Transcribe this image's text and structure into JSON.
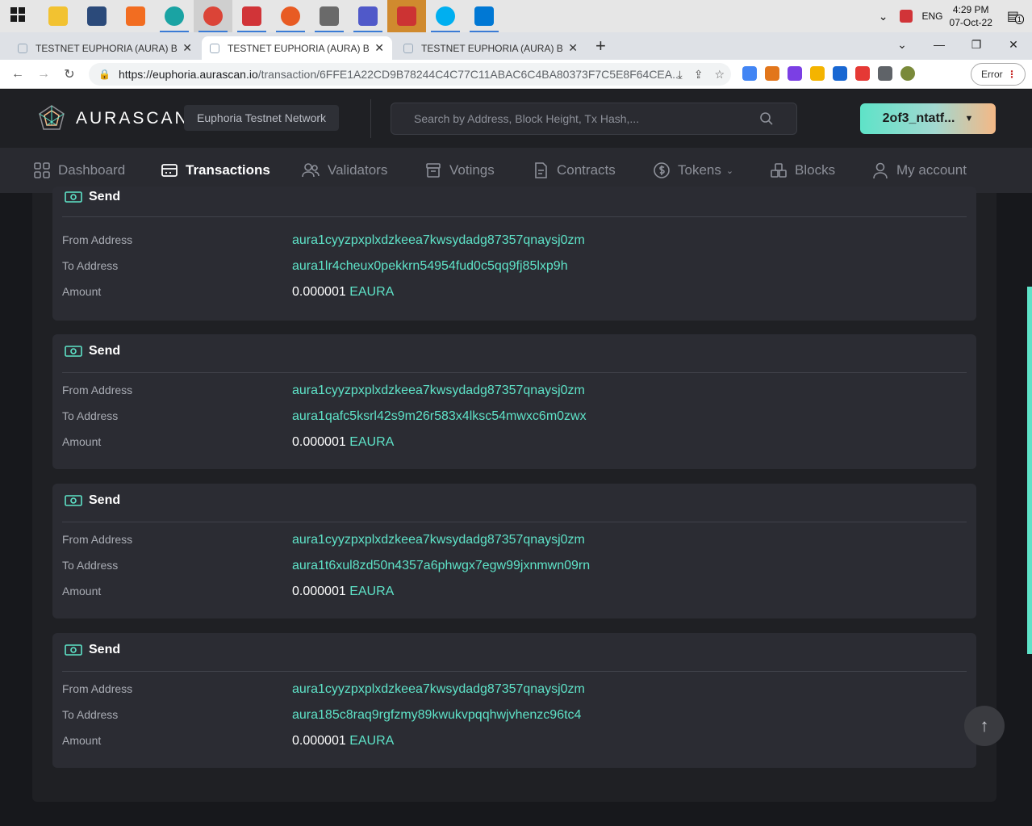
{
  "taskbar": {
    "apps": [
      {
        "name": "start",
        "color": "#1a1a1a"
      },
      {
        "name": "file-explorer",
        "color": "#f2c231"
      },
      {
        "name": "network-tool",
        "color": "#2b4a7a"
      },
      {
        "name": "brave-pen",
        "color": "#f26d21"
      },
      {
        "name": "edge",
        "color": "#1aa3a3"
      },
      {
        "name": "chrome",
        "color": "#db4437"
      },
      {
        "name": "pdf",
        "color": "#d13438"
      },
      {
        "name": "gateway",
        "color": "#e85b23"
      },
      {
        "name": "git",
        "color": "#6a6a6a"
      },
      {
        "name": "teams",
        "color": "#5059c9"
      },
      {
        "name": "package",
        "color": "#c33"
      },
      {
        "name": "skype",
        "color": "#00aff0"
      },
      {
        "name": "mail",
        "color": "#0078d4"
      }
    ],
    "language": "ENG",
    "time": "4:29 PM",
    "date": "07-Oct-22",
    "notification_count": "1"
  },
  "browser": {
    "tabs": [
      {
        "title": "TESTNET EUPHORIA (AURA) Bloc"
      },
      {
        "title": "TESTNET EUPHORIA (AURA) Bloc"
      },
      {
        "title": "TESTNET EUPHORIA (AURA) Bloc"
      }
    ],
    "new_tab": "+",
    "url_domain": "https://euphoria.aurascan.io",
    "url_path": "/transaction/6FFE1A22CD9B78244C4C77C11ABAC6C4BA80373F7C5E8F64CEA...",
    "error_label": "Error",
    "extension_colors": [
      "#4285f4",
      "#e2761b",
      "#7b3fe4",
      "#f4b400",
      "#1967d2",
      "#e53935",
      "#5f6368",
      "#5f6368"
    ]
  },
  "site": {
    "logo_text": "AURASCAN",
    "network": "Euphoria Testnet Network",
    "search_placeholder": "Search by Address, Block Height, Tx Hash,...",
    "wallet": "2of3_ntatf...",
    "accent": "#5ee3c8"
  },
  "menu": [
    {
      "label": "Dashboard",
      "icon": "dashboard-icon",
      "active": false
    },
    {
      "label": "Transactions",
      "icon": "transactions-icon",
      "active": true
    },
    {
      "label": "Validators",
      "icon": "validators-icon",
      "active": false
    },
    {
      "label": "Votings",
      "icon": "votings-icon",
      "active": false
    },
    {
      "label": "Contracts",
      "icon": "contracts-icon",
      "active": false
    },
    {
      "label": "Tokens",
      "icon": "tokens-icon",
      "active": false
    },
    {
      "label": "Blocks",
      "icon": "blocks-icon",
      "active": false
    },
    {
      "label": "My account",
      "icon": "account-icon",
      "active": false
    }
  ],
  "labels": {
    "from": "From Address",
    "to": "To Address",
    "amount": "Amount"
  },
  "messages": [
    {
      "type": "Send",
      "from": "aura1cyyzpxplxdzkeea7kwsydadg87357qnaysj0zm",
      "to": "aura1lr4cheux0pekkrn54954fud0c5qq9fj85lxp9h",
      "amount": "0.000001",
      "unit": "EAURA"
    },
    {
      "type": "Send",
      "from": "aura1cyyzpxplxdzkeea7kwsydadg87357qnaysj0zm",
      "to": "aura1qafc5ksrl42s9m26r583x4lksc54mwxc6m0zwx",
      "amount": "0.000001",
      "unit": "EAURA"
    },
    {
      "type": "Send",
      "from": "aura1cyyzpxplxdzkeea7kwsydadg87357qnaysj0zm",
      "to": "aura1t6xul8zd50n4357a6phwgx7egw99jxnmwn09rn",
      "amount": "0.000001",
      "unit": "EAURA"
    },
    {
      "type": "Send",
      "from": "aura1cyyzpxplxdzkeea7kwsydadg87357qnaysj0zm",
      "to": "aura185c8raq9rgfzmy89kwukvpqqhwjvhenzc96tc4",
      "amount": "0.000001",
      "unit": "EAURA"
    }
  ]
}
